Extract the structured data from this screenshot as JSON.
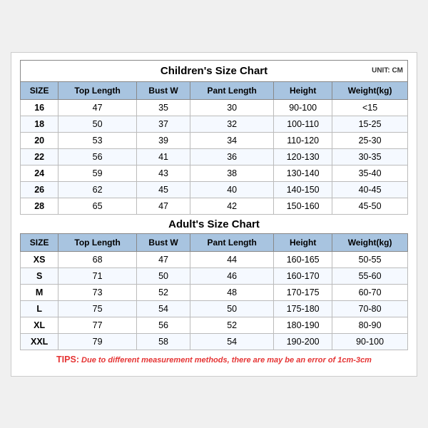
{
  "children_title": "Children's Size Chart",
  "adult_title": "Adult's Size Chart",
  "unit": "UNIT: CM",
  "headers": [
    "SIZE",
    "Top Length",
    "Bust W",
    "Pant Length",
    "Height",
    "Weight(kg)"
  ],
  "children_rows": [
    [
      "16",
      "47",
      "35",
      "30",
      "90-100",
      "<15"
    ],
    [
      "18",
      "50",
      "37",
      "32",
      "100-110",
      "15-25"
    ],
    [
      "20",
      "53",
      "39",
      "34",
      "110-120",
      "25-30"
    ],
    [
      "22",
      "56",
      "41",
      "36",
      "120-130",
      "30-35"
    ],
    [
      "24",
      "59",
      "43",
      "38",
      "130-140",
      "35-40"
    ],
    [
      "26",
      "62",
      "45",
      "40",
      "140-150",
      "40-45"
    ],
    [
      "28",
      "65",
      "47",
      "42",
      "150-160",
      "45-50"
    ]
  ],
  "adult_rows": [
    [
      "XS",
      "68",
      "47",
      "44",
      "160-165",
      "50-55"
    ],
    [
      "S",
      "71",
      "50",
      "46",
      "160-170",
      "55-60"
    ],
    [
      "M",
      "73",
      "52",
      "48",
      "170-175",
      "60-70"
    ],
    [
      "L",
      "75",
      "54",
      "50",
      "175-180",
      "70-80"
    ],
    [
      "XL",
      "77",
      "56",
      "52",
      "180-190",
      "80-90"
    ],
    [
      "XXL",
      "79",
      "58",
      "54",
      "190-200",
      "90-100"
    ]
  ],
  "tips": {
    "label": "TIPS:",
    "text": " Due to different measurement methods, there are may be an error of 1cm-3cm"
  }
}
